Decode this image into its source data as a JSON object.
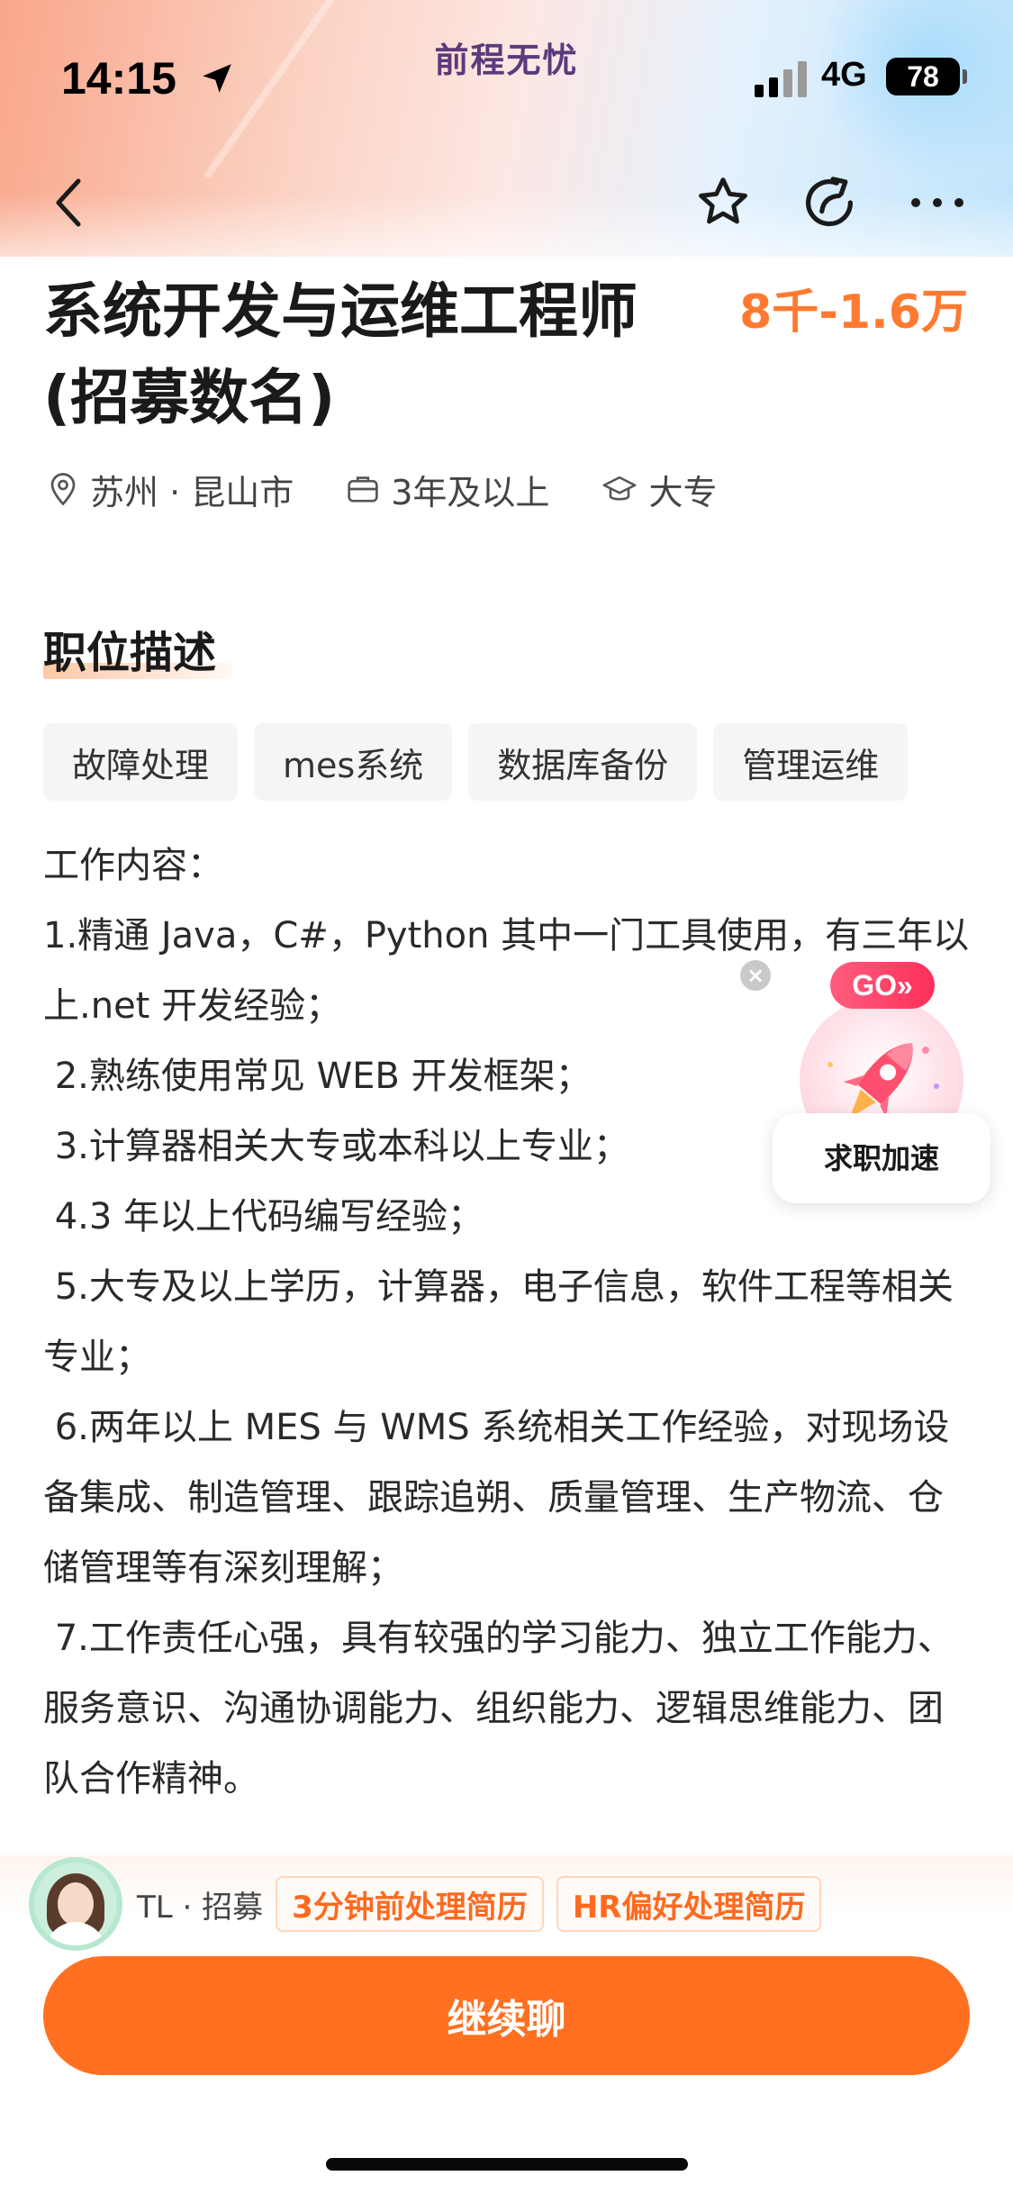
{
  "status_bar": {
    "time": "14:15",
    "brand": "前程无忧",
    "network": "4G",
    "battery": "78"
  },
  "nav": {
    "icons": [
      "back-icon",
      "star-icon",
      "share-icon",
      "more-icon"
    ]
  },
  "job": {
    "title": "系统开发与运维工程师(招募数名)",
    "salary": "8千-1.6万",
    "location": "苏州 · 昆山市",
    "experience": "3年及以上",
    "education": "大专"
  },
  "section": {
    "title": "职位描述",
    "tags": [
      "故障处理",
      "mes系统",
      "数据库备份",
      "管理运维"
    ]
  },
  "description": [
    "工作内容：",
    "1.精通 Java，C#，Python 其中一门工具使用，有三年以上.net 开发经验；",
    " 2.熟练使用常见 WEB 开发框架；",
    " 3.计算器相关大专或本科以上专业；",
    " 4.3 年以上代码编写经验；",
    " 5.大专及以上学历，计算器，电子信息，软件工程等相关专业；",
    " 6.两年以上 MES 与 WMS 系统相关工作经验，对现场设备集成、制造管理、跟踪追朔、质量管理、生产物流、仓储管理等有深刻理解；",
    " 7.工作责任心强，具有较强的学习能力、独立工作能力、服务意识、沟通协调能力、组织能力、逻辑思维能力、团队合作精神。"
  ],
  "promo": {
    "go_label": "GO»",
    "label": "求职加速",
    "close": "×"
  },
  "recruiter": {
    "name": "TL · 招募",
    "badges": [
      "3分钟前处理简历",
      "HR偏好处理简历"
    ]
  },
  "actions": {
    "chat_label": "继续聊"
  },
  "colors": {
    "accent": "#ff7020",
    "salary": "#ff7a30",
    "brand_text": "#5b3a7c"
  }
}
